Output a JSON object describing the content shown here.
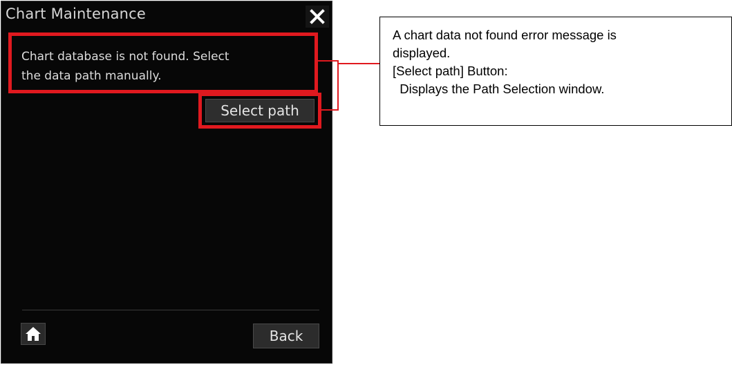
{
  "window": {
    "title": "Chart Maintenance",
    "message": "Chart database is not found. Select the data path manually.",
    "message_line1": "Chart database is not found. Select",
    "message_line2": "the data path manually.",
    "select_path_label": "Select path",
    "back_label": "Back"
  },
  "callout": {
    "line1": "A chart data not found error message is",
    "line2": "displayed.",
    "line3": "[Select path] Button:",
    "line4": "  Displays the Path Selection window."
  },
  "icons": {
    "close": "close-icon",
    "home": "home-icon"
  },
  "colors": {
    "highlight": "#e0191f",
    "panel_background": "#070707",
    "button_background": "#2e2e2e"
  }
}
